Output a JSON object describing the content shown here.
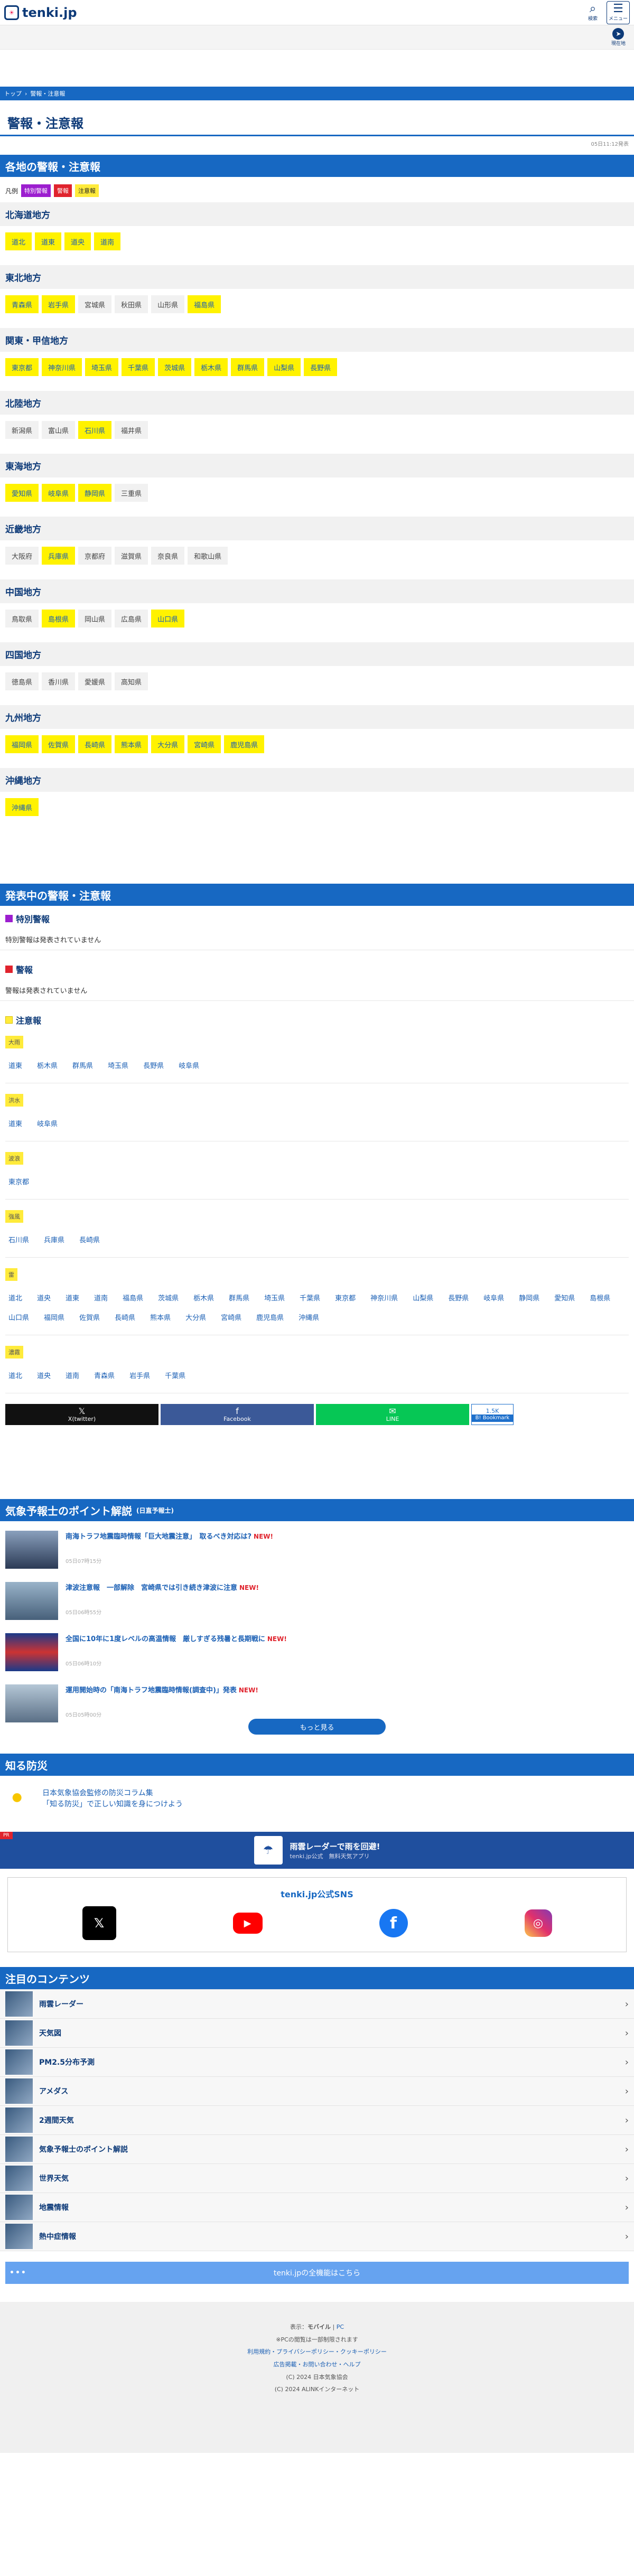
{
  "header": {
    "logo_text": "tenki.jp",
    "search_label": "検索",
    "menu_label": "メニュー",
    "location_label": "現在地"
  },
  "breadcrumb": [
    "トップ",
    "警報・注意報"
  ],
  "page_title": "警報・注意報",
  "updated_at": "05日11:12発表",
  "region_section": {
    "title": "各地の警報・注意報",
    "legend_label": "凡例",
    "legend": [
      "特別警報",
      "警報",
      "注意報"
    ],
    "regions": [
      {
        "name": "北海道地方",
        "prefs": [
          {
            "n": "道北",
            "s": "c"
          },
          {
            "n": "道東",
            "s": "c"
          },
          {
            "n": "道央",
            "s": "c"
          },
          {
            "n": "道南",
            "s": "c"
          }
        ]
      },
      {
        "name": "東北地方",
        "prefs": [
          {
            "n": "青森県",
            "s": "c"
          },
          {
            "n": "岩手県",
            "s": "c"
          },
          {
            "n": "宮城県",
            "s": ""
          },
          {
            "n": "秋田県",
            "s": ""
          },
          {
            "n": "山形県",
            "s": ""
          },
          {
            "n": "福島県",
            "s": "c"
          }
        ]
      },
      {
        "name": "関東・甲信地方",
        "prefs": [
          {
            "n": "東京都",
            "s": "c"
          },
          {
            "n": "神奈川県",
            "s": "c"
          },
          {
            "n": "埼玉県",
            "s": "c"
          },
          {
            "n": "千葉県",
            "s": "c"
          },
          {
            "n": "茨城県",
            "s": "c"
          },
          {
            "n": "栃木県",
            "s": "c"
          },
          {
            "n": "群馬県",
            "s": "c"
          },
          {
            "n": "山梨県",
            "s": "c"
          },
          {
            "n": "長野県",
            "s": "c"
          }
        ]
      },
      {
        "name": "北陸地方",
        "prefs": [
          {
            "n": "新潟県",
            "s": ""
          },
          {
            "n": "富山県",
            "s": ""
          },
          {
            "n": "石川県",
            "s": "c"
          },
          {
            "n": "福井県",
            "s": ""
          }
        ]
      },
      {
        "name": "東海地方",
        "prefs": [
          {
            "n": "愛知県",
            "s": "c"
          },
          {
            "n": "岐阜県",
            "s": "c"
          },
          {
            "n": "静岡県",
            "s": "c"
          },
          {
            "n": "三重県",
            "s": ""
          }
        ]
      },
      {
        "name": "近畿地方",
        "prefs": [
          {
            "n": "大阪府",
            "s": ""
          },
          {
            "n": "兵庫県",
            "s": "c"
          },
          {
            "n": "京都府",
            "s": ""
          },
          {
            "n": "滋賀県",
            "s": ""
          },
          {
            "n": "奈良県",
            "s": ""
          },
          {
            "n": "和歌山県",
            "s": ""
          }
        ]
      },
      {
        "name": "中国地方",
        "prefs": [
          {
            "n": "鳥取県",
            "s": ""
          },
          {
            "n": "島根県",
            "s": "c"
          },
          {
            "n": "岡山県",
            "s": ""
          },
          {
            "n": "広島県",
            "s": ""
          },
          {
            "n": "山口県",
            "s": "c"
          }
        ]
      },
      {
        "name": "四国地方",
        "prefs": [
          {
            "n": "徳島県",
            "s": ""
          },
          {
            "n": "香川県",
            "s": ""
          },
          {
            "n": "愛媛県",
            "s": ""
          },
          {
            "n": "高知県",
            "s": ""
          }
        ]
      },
      {
        "name": "九州地方",
        "prefs": [
          {
            "n": "福岡県",
            "s": "c"
          },
          {
            "n": "佐賀県",
            "s": "c"
          },
          {
            "n": "長崎県",
            "s": "c"
          },
          {
            "n": "熊本県",
            "s": "c"
          },
          {
            "n": "大分県",
            "s": "c"
          },
          {
            "n": "宮崎県",
            "s": "c"
          },
          {
            "n": "鹿児島県",
            "s": "c"
          }
        ]
      },
      {
        "name": "沖縄地方",
        "prefs": [
          {
            "n": "沖縄県",
            "s": "c"
          }
        ]
      }
    ]
  },
  "active_section": {
    "title": "発表中の警報・注意報",
    "special_title": "特別警報",
    "special_none": "特別警報は発表されていません",
    "warning_title": "警報",
    "warning_none": "警報は発表されていません",
    "advisory_title": "注意報",
    "advisories": [
      {
        "type": "大雨",
        "areas": [
          "道東",
          "栃木県",
          "群馬県",
          "埼玉県",
          "長野県",
          "岐阜県"
        ]
      },
      {
        "type": "洪水",
        "areas": [
          "道東",
          "岐阜県"
        ]
      },
      {
        "type": "波浪",
        "areas": [
          "東京都"
        ]
      },
      {
        "type": "強風",
        "areas": [
          "石川県",
          "兵庫県",
          "長崎県"
        ]
      },
      {
        "type": "雷",
        "areas": [
          "道北",
          "道央",
          "道東",
          "道南",
          "福島県",
          "茨城県",
          "栃木県",
          "群馬県",
          "埼玉県",
          "千葉県",
          "東京都",
          "神奈川県",
          "山梨県",
          "長野県",
          "岐阜県",
          "静岡県",
          "愛知県",
          "島根県",
          "山口県",
          "福岡県",
          "佐賀県",
          "長崎県",
          "熊本県",
          "大分県",
          "宮崎県",
          "鹿児島県",
          "沖縄県"
        ]
      },
      {
        "type": "濃霧",
        "areas": [
          "道北",
          "道央",
          "道南",
          "青森県",
          "岩手県",
          "千葉県"
        ]
      }
    ]
  },
  "share": {
    "x_label": "X(twitter)",
    "fb_label": "Facebook",
    "line_label": "LINE",
    "hb_count": "1.5K",
    "hb_label": "B! Bookmark"
  },
  "points": {
    "title": "気象予報士のポイント解説",
    "subtitle": "(日直予報士)",
    "articles": [
      {
        "title": "南海トラフ地震臨時情報「巨大地震注意」　取るべき対応は?",
        "new": "NEW!",
        "time": "05日07時15分"
      },
      {
        "title": "津波注意報　一部解除　宮崎県では引き続き津波に注意",
        "new": "NEW!",
        "time": "05日06時55分"
      },
      {
        "title": "全国に10年に1度レベルの高温情報　厳しすぎる残暑と長期戦に",
        "new": "NEW!",
        "time": "05日06時10分"
      },
      {
        "title": "運用開始時の「南海トラフ地震臨時情報(調査中)」発表",
        "new": "NEW!",
        "time": "05日05時00分"
      }
    ],
    "more_label": "もっと見る"
  },
  "bousai": {
    "title": "知る防災",
    "line1": "日本気象協会監修の防災コラム集",
    "line2": "「知る防災」で正しい知識を身につけよう"
  },
  "radar_banner": {
    "ad_label": "PR",
    "title": "雨雲レーダーで雨を回避!",
    "subtitle": "tenki.jp公式　無料天気アプリ"
  },
  "sns": {
    "title": "tenki.jp公式SNS",
    "items": [
      "X",
      "YouTube",
      "Facebook",
      "Instagram"
    ]
  },
  "featured": {
    "title": "注目のコンテンツ",
    "items": [
      "雨雲レーダー",
      "天気図",
      "PM2.5分布予測",
      "アメダス",
      "2週間天気",
      "気象予報士のポイント解説",
      "世界天気",
      "地震情報",
      "熱中症情報"
    ],
    "all_services": "tenki.jpの全機能はこちら"
  },
  "footer": {
    "display": "表示：",
    "mobile": "モバイル",
    "pc": "PC",
    "pc_note": "※PCの閲覧は一部制限されます",
    "links1": "利用規約・プライバシーポリシー・クッキーポリシー",
    "links2": "広告掲載・お問い合わせ・ヘルプ",
    "copy1": "(C) 2024 日本気象協会",
    "copy2": "(C) 2024 ALINKインターネット"
  }
}
